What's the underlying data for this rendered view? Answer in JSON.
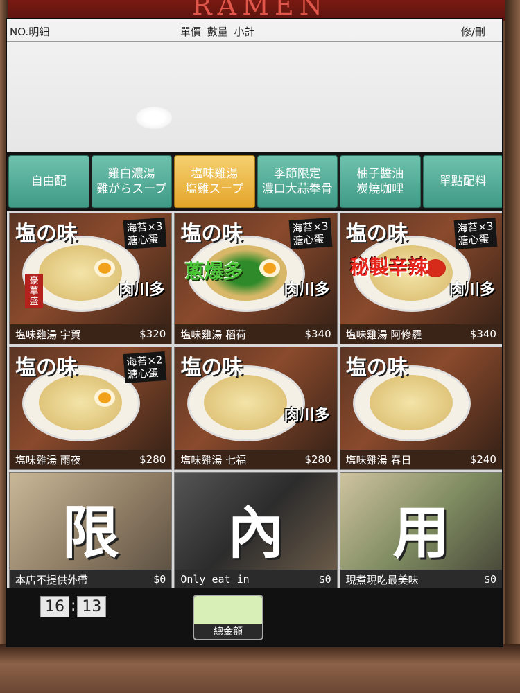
{
  "store_sign": "RAMEN",
  "order_header": {
    "number_detail": "NO.明細",
    "price_qty_subtotal": "單價 數量 小計",
    "edit_delete": "修/刪"
  },
  "tabs": [
    {
      "label": "自由配"
    },
    {
      "label": "雞白濃湯\n雞がらスープ"
    },
    {
      "label": "塩味雞湯\n塩雞スープ"
    },
    {
      "label": "季節限定\n濃口大蒜拳骨"
    },
    {
      "label": "柚子醬油\n炭燒咖哩"
    },
    {
      "label": "單點配料"
    }
  ],
  "active_tab": 2,
  "menu_items": [
    {
      "name": "塩味雞湯 宇賀",
      "price": "$320",
      "logo": "塩の味",
      "nori": "海苔×3\n溏心蛋",
      "meat": "肉川多",
      "badge": "豪\n華\n盛"
    },
    {
      "name": "塩味雞湯 稻荷",
      "price": "$340",
      "logo": "塩の味",
      "nori": "海苔×3\n溏心蛋",
      "meat": "肉川多",
      "promo": "蔥爆多"
    },
    {
      "name": "塩味雞湯 阿修羅",
      "price": "$340",
      "logo": "塩の味",
      "nori": "海苔×3\n溏心蛋",
      "meat": "肉川多",
      "promo": "秘製辛辣"
    },
    {
      "name": "塩味雞湯 雨夜",
      "price": "$280",
      "logo": "塩の味",
      "nori": "海苔×2\n溏心蛋"
    },
    {
      "name": "塩味雞湯 七福",
      "price": "$280",
      "logo": "塩の味",
      "meat": "肉川多"
    },
    {
      "name": "塩味雞湯 春日",
      "price": "$240",
      "logo": "塩の味"
    }
  ],
  "notices": [
    {
      "char": "限",
      "text": "本店不提供外帶",
      "price": "$0"
    },
    {
      "char": "內",
      "text": "Only eat in",
      "price": "$0"
    },
    {
      "char": "用",
      "text": "現煮現吃最美味",
      "price": "$0"
    }
  ],
  "clock": {
    "hour": "16",
    "minute": "13"
  },
  "total_label": "總金額"
}
